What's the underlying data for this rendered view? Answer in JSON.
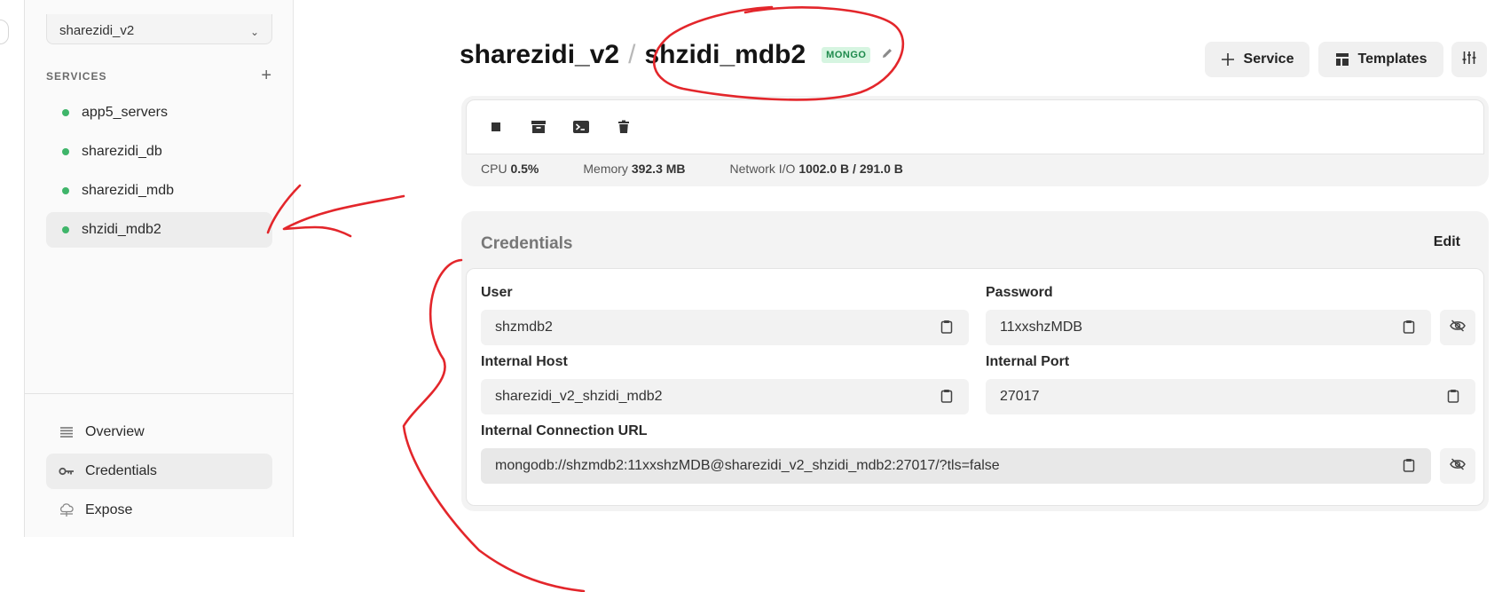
{
  "sidebar": {
    "project_select": "sharezidi_v2",
    "services_heading": "SERVICES",
    "services": [
      {
        "label": "app5_servers"
      },
      {
        "label": "sharezidi_db"
      },
      {
        "label": "sharezidi_mdb"
      },
      {
        "label": "shzidi_mdb2"
      }
    ],
    "nav": [
      {
        "label": "Overview"
      },
      {
        "label": "Credentials"
      },
      {
        "label": "Expose"
      }
    ]
  },
  "header": {
    "project": "sharezidi_v2",
    "separator": "/",
    "service": "shzidi_mdb2",
    "badge": "MONGO",
    "service_button": "Service",
    "templates_button": "Templates"
  },
  "status": {
    "cpu_label": "CPU",
    "cpu_value": "0.5%",
    "memory_label": "Memory",
    "memory_value": "392.3 MB",
    "network_label": "Network I/O",
    "network_value": "1002.0 B / 291.0 B"
  },
  "credentials": {
    "title": "Credentials",
    "edit_label": "Edit",
    "user_label": "User",
    "user_value": "shzmdb2",
    "password_label": "Password",
    "password_value": "11xxshzMDB",
    "host_label": "Internal Host",
    "host_value": "sharezidi_v2_shzidi_mdb2",
    "port_label": "Internal Port",
    "port_value": "27017",
    "url_label": "Internal Connection URL",
    "url_value": "mongodb://shzmdb2:11xxshzMDB@sharezidi_v2_shzidi_mdb2:27017/?tls=false"
  },
  "colors": {
    "status_dot": "#3fb56a",
    "badge_text": "#1e8a4c",
    "badge_bg": "#d6f5e1",
    "annotation": "#e3262b"
  },
  "icons": [
    "stop-icon",
    "archive-icon",
    "terminal-icon",
    "trash-icon",
    "copy-icon",
    "eye-off-icon",
    "plus-icon",
    "templates-icon",
    "sliders-icon",
    "pencil-icon",
    "list-icon",
    "key-icon",
    "cloud-icon"
  ]
}
